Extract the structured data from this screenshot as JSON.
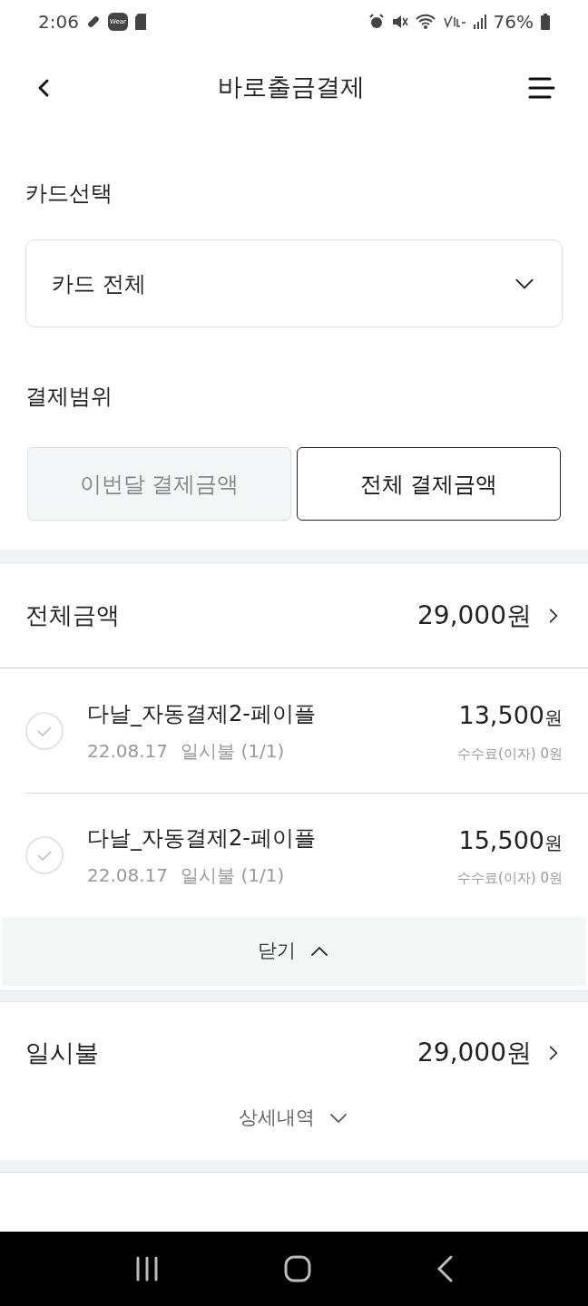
{
  "status_bar": {
    "time": "2:06",
    "wear_badge": "Wear",
    "battery": "76%"
  },
  "header": {
    "title": "바로출금결제"
  },
  "card_select": {
    "label": "카드선택",
    "value": "카드 전체"
  },
  "range": {
    "label": "결제범위",
    "tabs": [
      {
        "label": "이번달 결제금액",
        "selected": false
      },
      {
        "label": "전체 결제금액",
        "selected": true
      }
    ]
  },
  "total": {
    "label": "전체금액",
    "amount": "29,000원",
    "expanded": true,
    "items": [
      {
        "name": "다날_자동결제2-페이플",
        "date": "22.08.17",
        "plan": "일시불 (1/1)",
        "amount": "13,500",
        "unit": "원",
        "fee": "수수료(이자) 0원",
        "checked": false
      },
      {
        "name": "다날_자동결제2-페이플",
        "date": "22.08.17",
        "plan": "일시불 (1/1)",
        "amount": "15,500",
        "unit": "원",
        "fee": "수수료(이자) 0원",
        "checked": false
      }
    ],
    "toggle": "닫기"
  },
  "lump_sum": {
    "label": "일시불",
    "amount": "29,000원",
    "expanded": false,
    "toggle": "상세내역"
  }
}
